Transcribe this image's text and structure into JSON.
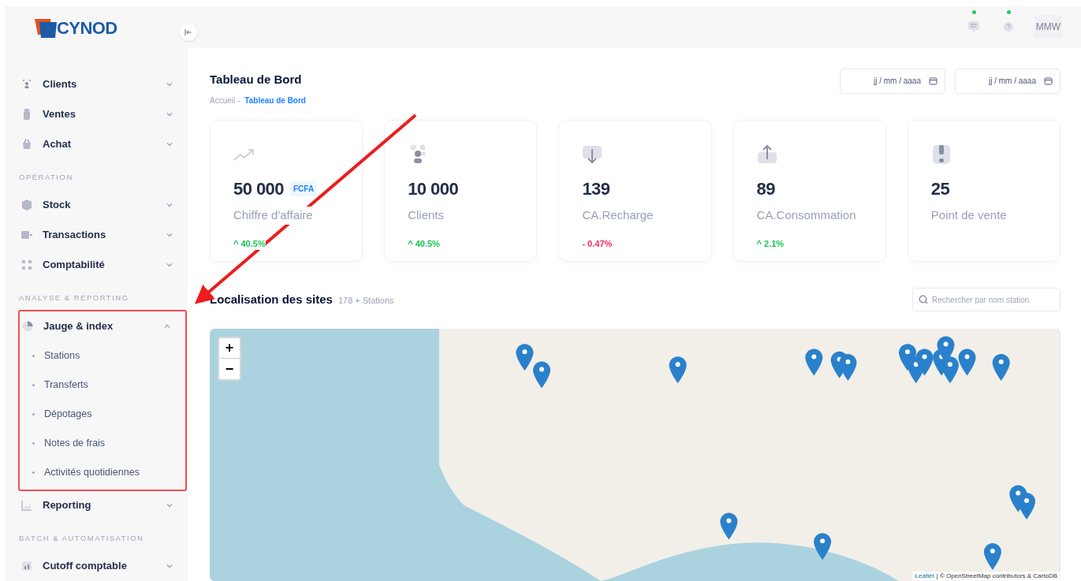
{
  "sidebar": {
    "logo": "CYNOD",
    "sections": [
      {
        "items": [
          {
            "label": "Clients",
            "expanded": false
          },
          {
            "label": "Ventes",
            "expanded": false
          },
          {
            "label": "Achat",
            "expanded": false
          }
        ]
      },
      {
        "heading": "OPÉRATION",
        "items": [
          {
            "label": "Stock",
            "expanded": false
          },
          {
            "label": "Transactions",
            "expanded": false
          },
          {
            "label": "Comptabilité",
            "expanded": false
          }
        ]
      },
      {
        "heading": "ANALYSE & REPORTING",
        "items": [
          {
            "label": "Jauge & index",
            "expanded": true,
            "highlighted": true,
            "children": [
              {
                "label": "Stations"
              },
              {
                "label": "Transferts"
              },
              {
                "label": "Dépotages"
              },
              {
                "label": "Notes de frais"
              },
              {
                "label": "Activités quotidiennes"
              }
            ]
          },
          {
            "label": "Reporting",
            "expanded": false
          }
        ]
      },
      {
        "heading": "BATCH & AUTOMATISATION",
        "items": [
          {
            "label": "Cutoff comptable",
            "expanded": false
          }
        ]
      }
    ]
  },
  "header": {
    "icons": [
      {
        "notification": true
      },
      {
        "notification": true
      }
    ],
    "avatar": "MMW"
  },
  "page": {
    "title": "Tableau de Bord",
    "breadcrumb": [
      "Accueil -",
      "Tableau de Bord"
    ],
    "date_fields": [
      {
        "placeholder": "jj / mm / aaaa"
      },
      {
        "placeholder": "jj / mm / aaaa"
      }
    ]
  },
  "stats": [
    {
      "value": "50 000",
      "unit": "FCFA",
      "label": "Chiffre d'affaire",
      "trend": "^ 40.5%",
      "negative": false
    },
    {
      "value": "10 000",
      "label": "Clients",
      "trend": "^ 40.5%",
      "negative": false
    },
    {
      "value": "139",
      "label": "CA.Recharge",
      "trend": "- 0.47%",
      "negative": true
    },
    {
      "value": "89",
      "label": "CA.Consommation",
      "trend": "^ 2.1%",
      "negative": false
    },
    {
      "value": "25",
      "label": "Point de vente"
    }
  ],
  "map_section": {
    "title": "Localisation des sites",
    "count": "178 + Stations",
    "search": {
      "placeholder": "Rechercher par nom station"
    },
    "zoom_in": "+",
    "zoom_out": "−",
    "attribution_link": "Leaflet",
    "attribution": "| © OpenStreetMap contributors & CartoDB"
  }
}
